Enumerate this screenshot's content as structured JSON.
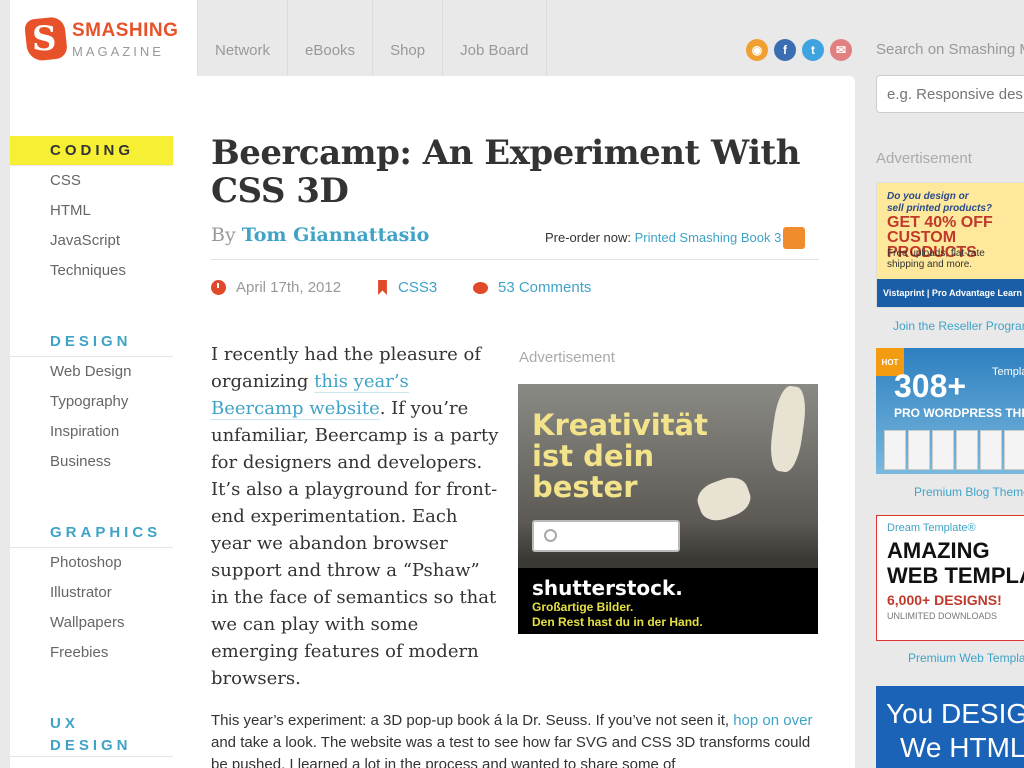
{
  "logo": {
    "line1": "SMASHING",
    "line2": "MAGAZINE"
  },
  "topnav": [
    "Network",
    "eBooks",
    "Shop",
    "Job Board"
  ],
  "social": [
    {
      "name": "rss-icon",
      "color": "#f0a030",
      "glyph": "◉"
    },
    {
      "name": "facebook-icon",
      "color": "#3b6db3",
      "glyph": "f"
    },
    {
      "name": "twitter-icon",
      "color": "#3fa3e0",
      "glyph": "t"
    },
    {
      "name": "newsletter-icon",
      "color": "#e08080",
      "glyph": "✉"
    }
  ],
  "search": {
    "label": "Search on Smashing M",
    "placeholder": "e.g. Responsive des"
  },
  "sidebar": {
    "coding": {
      "head": "CODING",
      "items": [
        "CSS",
        "HTML",
        "JavaScript",
        "Techniques"
      ]
    },
    "design": {
      "head": "DESIGN",
      "items": [
        "Web Design",
        "Typography",
        "Inspiration",
        "Business"
      ]
    },
    "graphics": {
      "head": "GRAPHICS",
      "items": [
        "Photoshop",
        "Illustrator",
        "Wallpapers",
        "Freebies"
      ]
    },
    "ux": {
      "head1": "UX",
      "head2": "DESIGN"
    }
  },
  "article": {
    "title": "Beercamp: An Experiment With CSS 3D",
    "by": "By",
    "author": "Tom Giannattasio",
    "preorder_text": "Pre-order now:",
    "preorder_link": "Printed Smashing Book 3",
    "date": "April 17th, 2012",
    "tag": "CSS3",
    "comments": "53 Comments",
    "lead_1": "I recently had the pleasure of organizing ",
    "lead_link": "this year’s Beercamp website",
    "lead_2": ". If you’re unfamiliar, Beercamp is a party for designers and developers. It’s also a playground for front-end experimentation. Each year we abandon browser support and throw a “Pshaw” in the face of semantics so that we can play with some emerging features of modern browsers.",
    "body_1": "This year’s experiment: a 3D pop-up book á la Dr. Seuss. If you’ve not seen it, ",
    "body_link": "hop on over",
    "body_2": " and take a look. The website was a test to see how far SVG and CSS 3D transforms could be pushed. I learned a lot in the process and wanted to share some of"
  },
  "inline_ad": {
    "label": "Advertisement",
    "headline1": "Kreativität",
    "headline2": "ist dein",
    "headline3": "bester",
    "brand": "shutterstock.",
    "tag1": "Großartige Bilder.",
    "tag2": "Den Rest hast du in der Hand."
  },
  "right": {
    "label": "Advertisement",
    "vista": {
      "t1": "Do you design or",
      "t1b": "sell printed products?",
      "t2": "GET 40% OFF",
      "t2b": "CUSTOM PRODUCTS",
      "t3": "Free uploads, flat-rate",
      "t3b": "shipping and more.",
      "bar": "Vistaprint | Pro Advantage   Learn",
      "caption": "Join the Reseller Program"
    },
    "wp": {
      "hot": "HOT",
      "num": "308+",
      "sub": "PRO WORDPRESS THEMES",
      "templ": "Templates",
      "caption": "Premium Blog Themes"
    },
    "dt": {
      "l1": "Dream Template®",
      "l2a": "AMAZING",
      "l2b": "WEB TEMPLATES",
      "l3": "6,000+ DESIGNS!",
      "l4": "UNLIMITED DOWNLOADS",
      "caption": "Premium Web Templates"
    },
    "yd": {
      "y1": "You DESIGN",
      "y2": "We HTML"
    }
  },
  "colors": {
    "accent": "#3fa3c7",
    "brand": "#e8522a",
    "highlight": "#f7ef34"
  }
}
